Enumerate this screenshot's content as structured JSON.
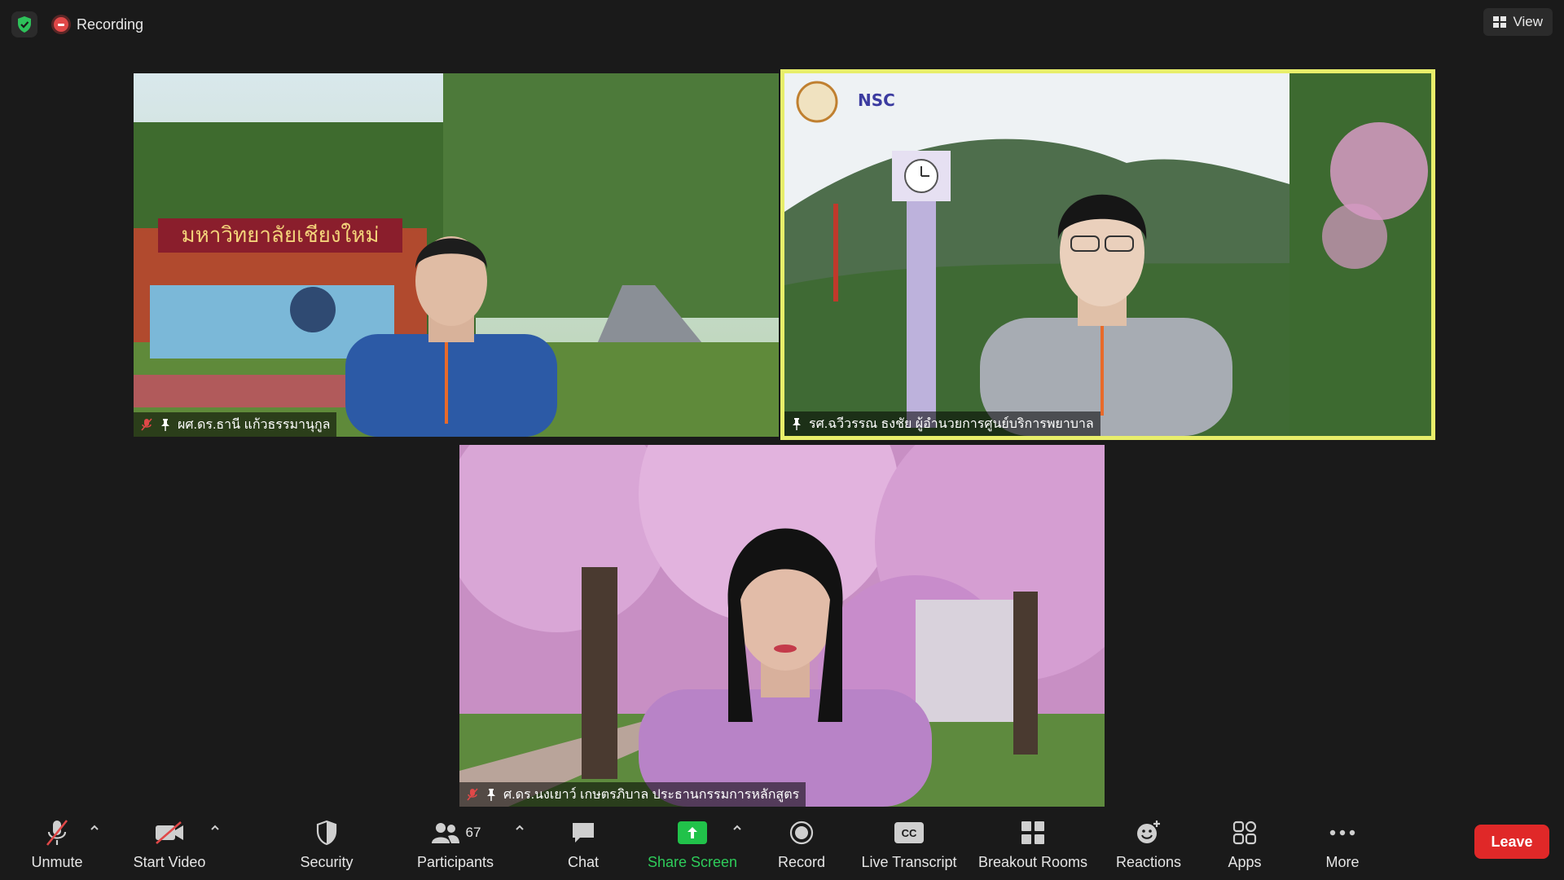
{
  "top_bar": {
    "recording_label": "Recording",
    "view_label": "View"
  },
  "participants": [
    {
      "name": "ผศ.ดร.ธานี แก้วธรรมานุกูล",
      "muted": true,
      "pinned": true,
      "active_speaker": false
    },
    {
      "name": "รศ.ฉวีวรรณ ธงชัย ผู้อำนวยการศูนย์บริการพยาบาล",
      "muted": false,
      "pinned": true,
      "active_speaker": true
    },
    {
      "name": "ศ.ดร.นงเยาว์ เกษตรภิบาล ประธานกรรมการหลักสูตร",
      "muted": true,
      "pinned": true,
      "active_speaker": false
    }
  ],
  "backgrounds": {
    "tile1_sign_text": "มหาวิทยาลัยเชียงใหม่",
    "tile2_logo_text": "NSC"
  },
  "toolbar": {
    "unmute_label": "Unmute",
    "start_video_label": "Start Video",
    "security_label": "Security",
    "participants_label": "Participants",
    "participants_count": "67",
    "chat_label": "Chat",
    "share_screen_label": "Share Screen",
    "record_label": "Record",
    "live_transcript_label": "Live Transcript",
    "live_transcript_badge": "CC",
    "breakout_rooms_label": "Breakout Rooms",
    "reactions_label": "Reactions",
    "apps_label": "Apps",
    "more_label": "More",
    "leave_label": "Leave"
  },
  "colors": {
    "active_speaker_border": "#e8ee6a",
    "share_green": "#21c24a",
    "leave_red": "#e02828",
    "muted_red": "#e04848"
  }
}
